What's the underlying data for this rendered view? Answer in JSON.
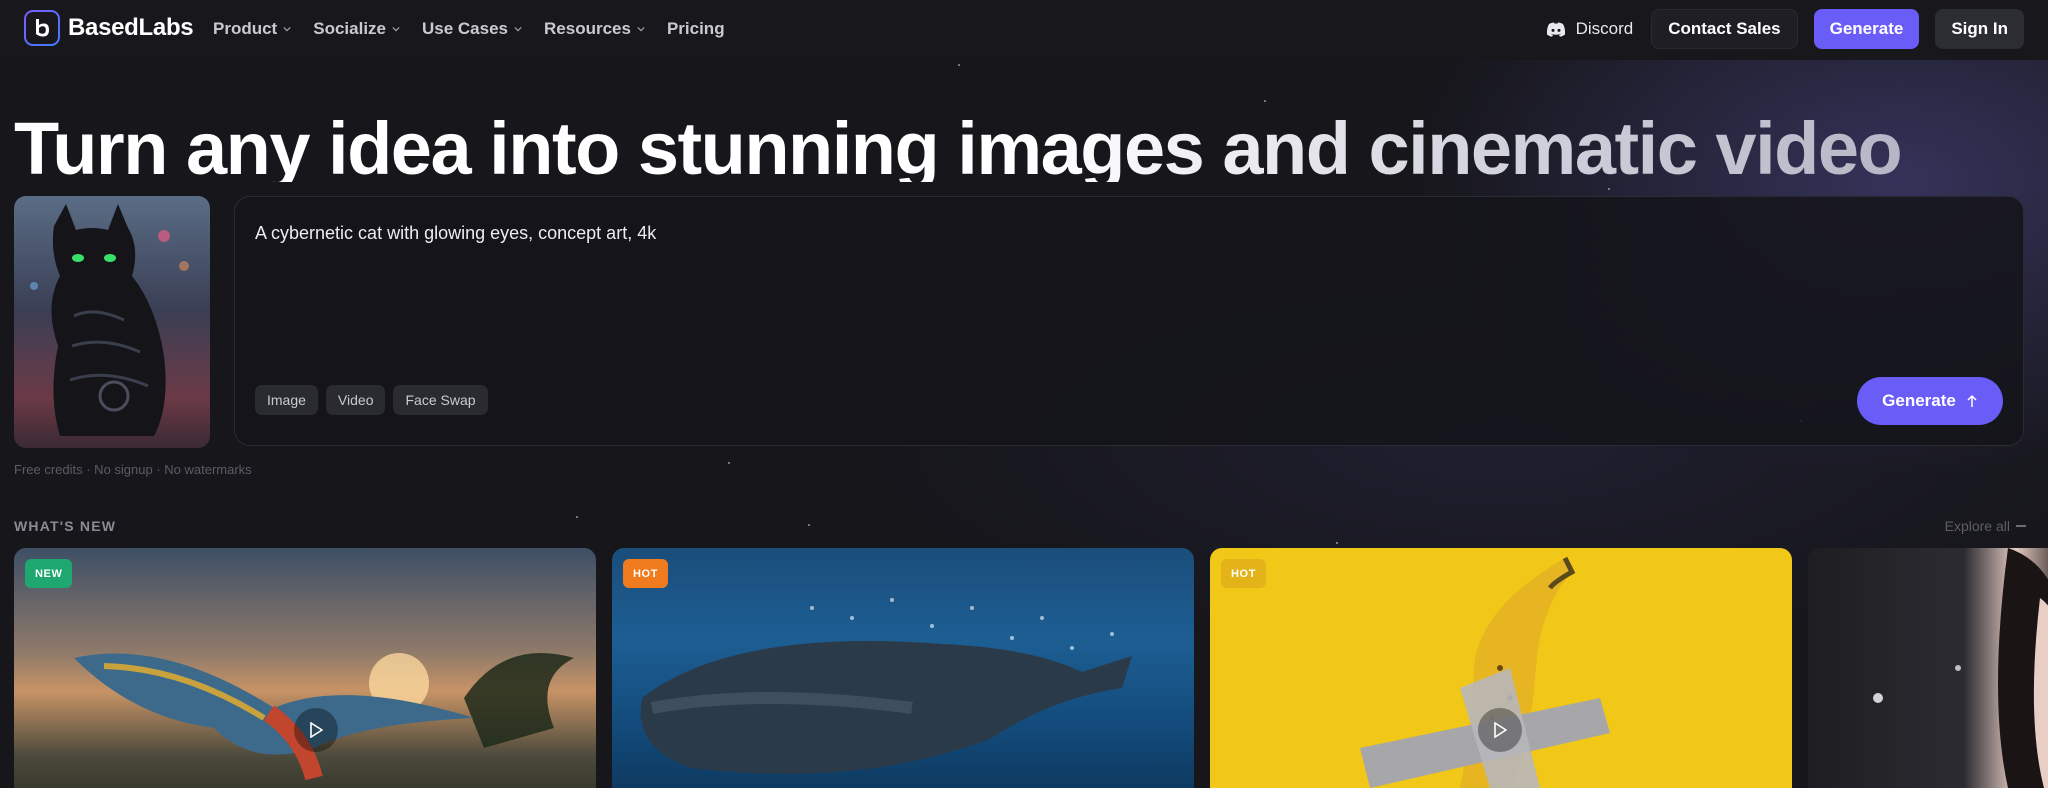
{
  "nav": {
    "brand": "BasedLabs",
    "links": [
      {
        "label": "Product",
        "dropdown": true
      },
      {
        "label": "Socialize",
        "dropdown": true
      },
      {
        "label": "Use Cases",
        "dropdown": true
      },
      {
        "label": "Resources",
        "dropdown": true
      },
      {
        "label": "Pricing",
        "dropdown": false
      }
    ],
    "discord": "Discord",
    "contact": "Contact Sales",
    "generate": "Generate",
    "signin": "Sign In"
  },
  "hero": {
    "title": "Turn any idea into stunning images and cinematic video",
    "prompt": "A cybernetic cat with glowing eyes, concept art, 4k",
    "chips": [
      "Image",
      "Video",
      "Face Swap"
    ],
    "generate": "Generate",
    "note": "Free credits · No signup · No watermarks"
  },
  "whats_new": {
    "label": "WHAT'S NEW",
    "explore": "Explore all",
    "cards": [
      {
        "badge": "NEW",
        "badge_color": "#1ea870",
        "icon": "play-icon"
      },
      {
        "badge": "HOT",
        "badge_color": "#f07a1e"
      },
      {
        "badge": "HOT",
        "badge_color": "#e3b319",
        "icon": "play-icon"
      },
      {
        "badge": ""
      }
    ]
  },
  "colors": {
    "accent": "#6a5cf6",
    "background": "#16161b"
  }
}
